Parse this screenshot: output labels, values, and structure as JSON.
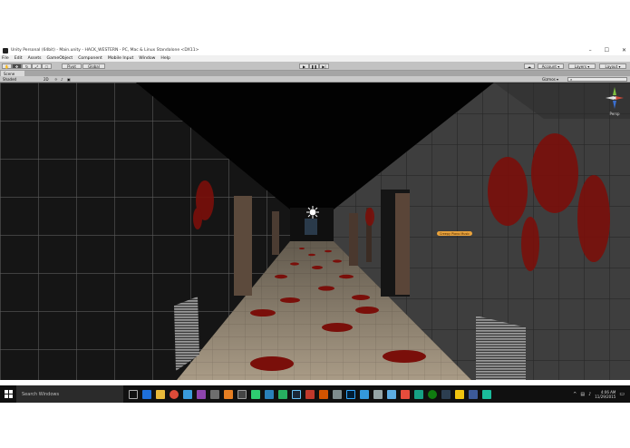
{
  "window": {
    "title": "Unity Personal (64bit) - Main.unity - HACK_WESTERN - PC, Mac & Linux Standalone <DX11>",
    "controls": [
      "–",
      "☐",
      "✕"
    ]
  },
  "menu": [
    "File",
    "Edit",
    "Assets",
    "GameObject",
    "Component",
    "Mobile Input",
    "Window",
    "Help"
  ],
  "toolbar": {
    "pivot_label": "Pivot",
    "global_label": "Global",
    "account_label": "Account",
    "layers_label": "Layers",
    "layout_label": "Layout"
  },
  "scene": {
    "tab_label": "Scene",
    "shading_mode": "Shaded",
    "mode_2d": "2D",
    "gizmos_label": "Gizmos",
    "persp_label": "Persp",
    "object_tag": "Creepy Piano Music"
  },
  "taskbar": {
    "search_placeholder": "Search Windows",
    "time": "4:06 AM",
    "date": "11/29/2015"
  },
  "colors": {
    "toolbar_bg": "#c2c2c2",
    "viewport_bg": "#000000",
    "tag_orange": "#e9a23b",
    "blood_red": "#7a0f0a"
  }
}
